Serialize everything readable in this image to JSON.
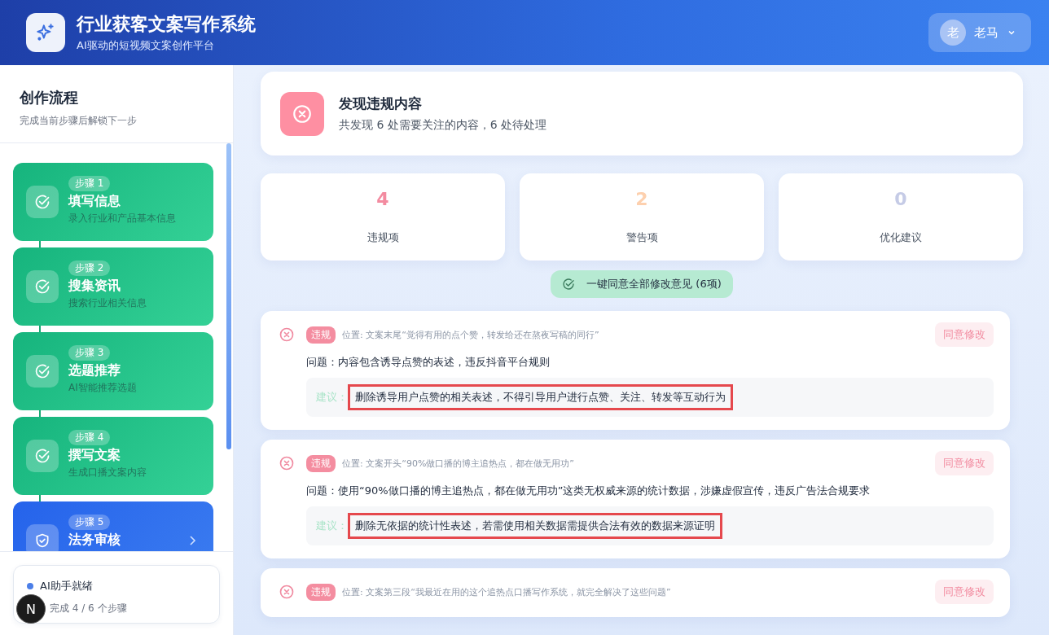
{
  "header": {
    "title": "行业获客文案写作系统",
    "subtitle": "AI驱动的短视频文案创作平台",
    "user": {
      "avatar_text": "老",
      "name": "老马"
    }
  },
  "sidebar": {
    "title": "创作流程",
    "subtitle": "完成当前步骤后解锁下一步",
    "steps": [
      {
        "badge": "步骤 1",
        "title": "填写信息",
        "desc": "录入行业和产品基本信息",
        "completed": true
      },
      {
        "badge": "步骤 2",
        "title": "搜集资讯",
        "desc": "搜索行业相关信息",
        "completed": true
      },
      {
        "badge": "步骤 3",
        "title": "选题推荐",
        "desc": "AI智能推荐选题",
        "completed": true
      },
      {
        "badge": "步骤 4",
        "title": "撰写文案",
        "desc": "生成口播文案内容",
        "completed": true
      },
      {
        "badge": "步骤 5",
        "title": "法务审核",
        "completed": false
      }
    ],
    "status": {
      "title": "AI助手就绪",
      "progress": "完成 4 / 6 个步骤"
    }
  },
  "summary": {
    "title": "发现违规内容",
    "text": "共发现 6 处需要关注的内容，6 处待处理"
  },
  "stats": [
    {
      "value": "4",
      "label": "违规项",
      "color": "#f38ba0"
    },
    {
      "value": "2",
      "label": "警告项",
      "color": "#fdd0ae"
    },
    {
      "value": "0",
      "label": "优化建议",
      "color": "#c5cbe6"
    }
  ],
  "accept_all_button": "一键同意全部修改意见 (6项)",
  "issues": [
    {
      "tag": "违规",
      "location": "位置: 文案末尾“觉得有用的点个赞，转发给还在熬夜写稿的同行”",
      "button": "同意修改",
      "problem": "问题：内容包含诱导点赞的表述，违反抖音平台规则",
      "suggestion_label": "建议：",
      "suggestion": "删除诱导用户点赞的相关表述，不得引导用户进行点赞、关注、转发等互动行为",
      "highlighted": true
    },
    {
      "tag": "违规",
      "location": "位置: 文案开头“90%做口播的博主追热点，都在做无用功”",
      "button": "同意修改",
      "problem": "问题：使用“90%做口播的博主追热点，都在做无用功”这类无权威来源的统计数据，涉嫌虚假宣传，违反广告法合规要求",
      "suggestion_label": "建议：",
      "suggestion": "删除无依据的统计性表述，若需使用相关数据需提供合法有效的数据来源证明",
      "highlighted": true
    },
    {
      "tag": "违规",
      "location": "位置: 文案第三段“我最近在用的这个追热点口播写作系统，就完全解决了这些问题”",
      "button": "同意修改"
    }
  ],
  "dev_badge": "N"
}
